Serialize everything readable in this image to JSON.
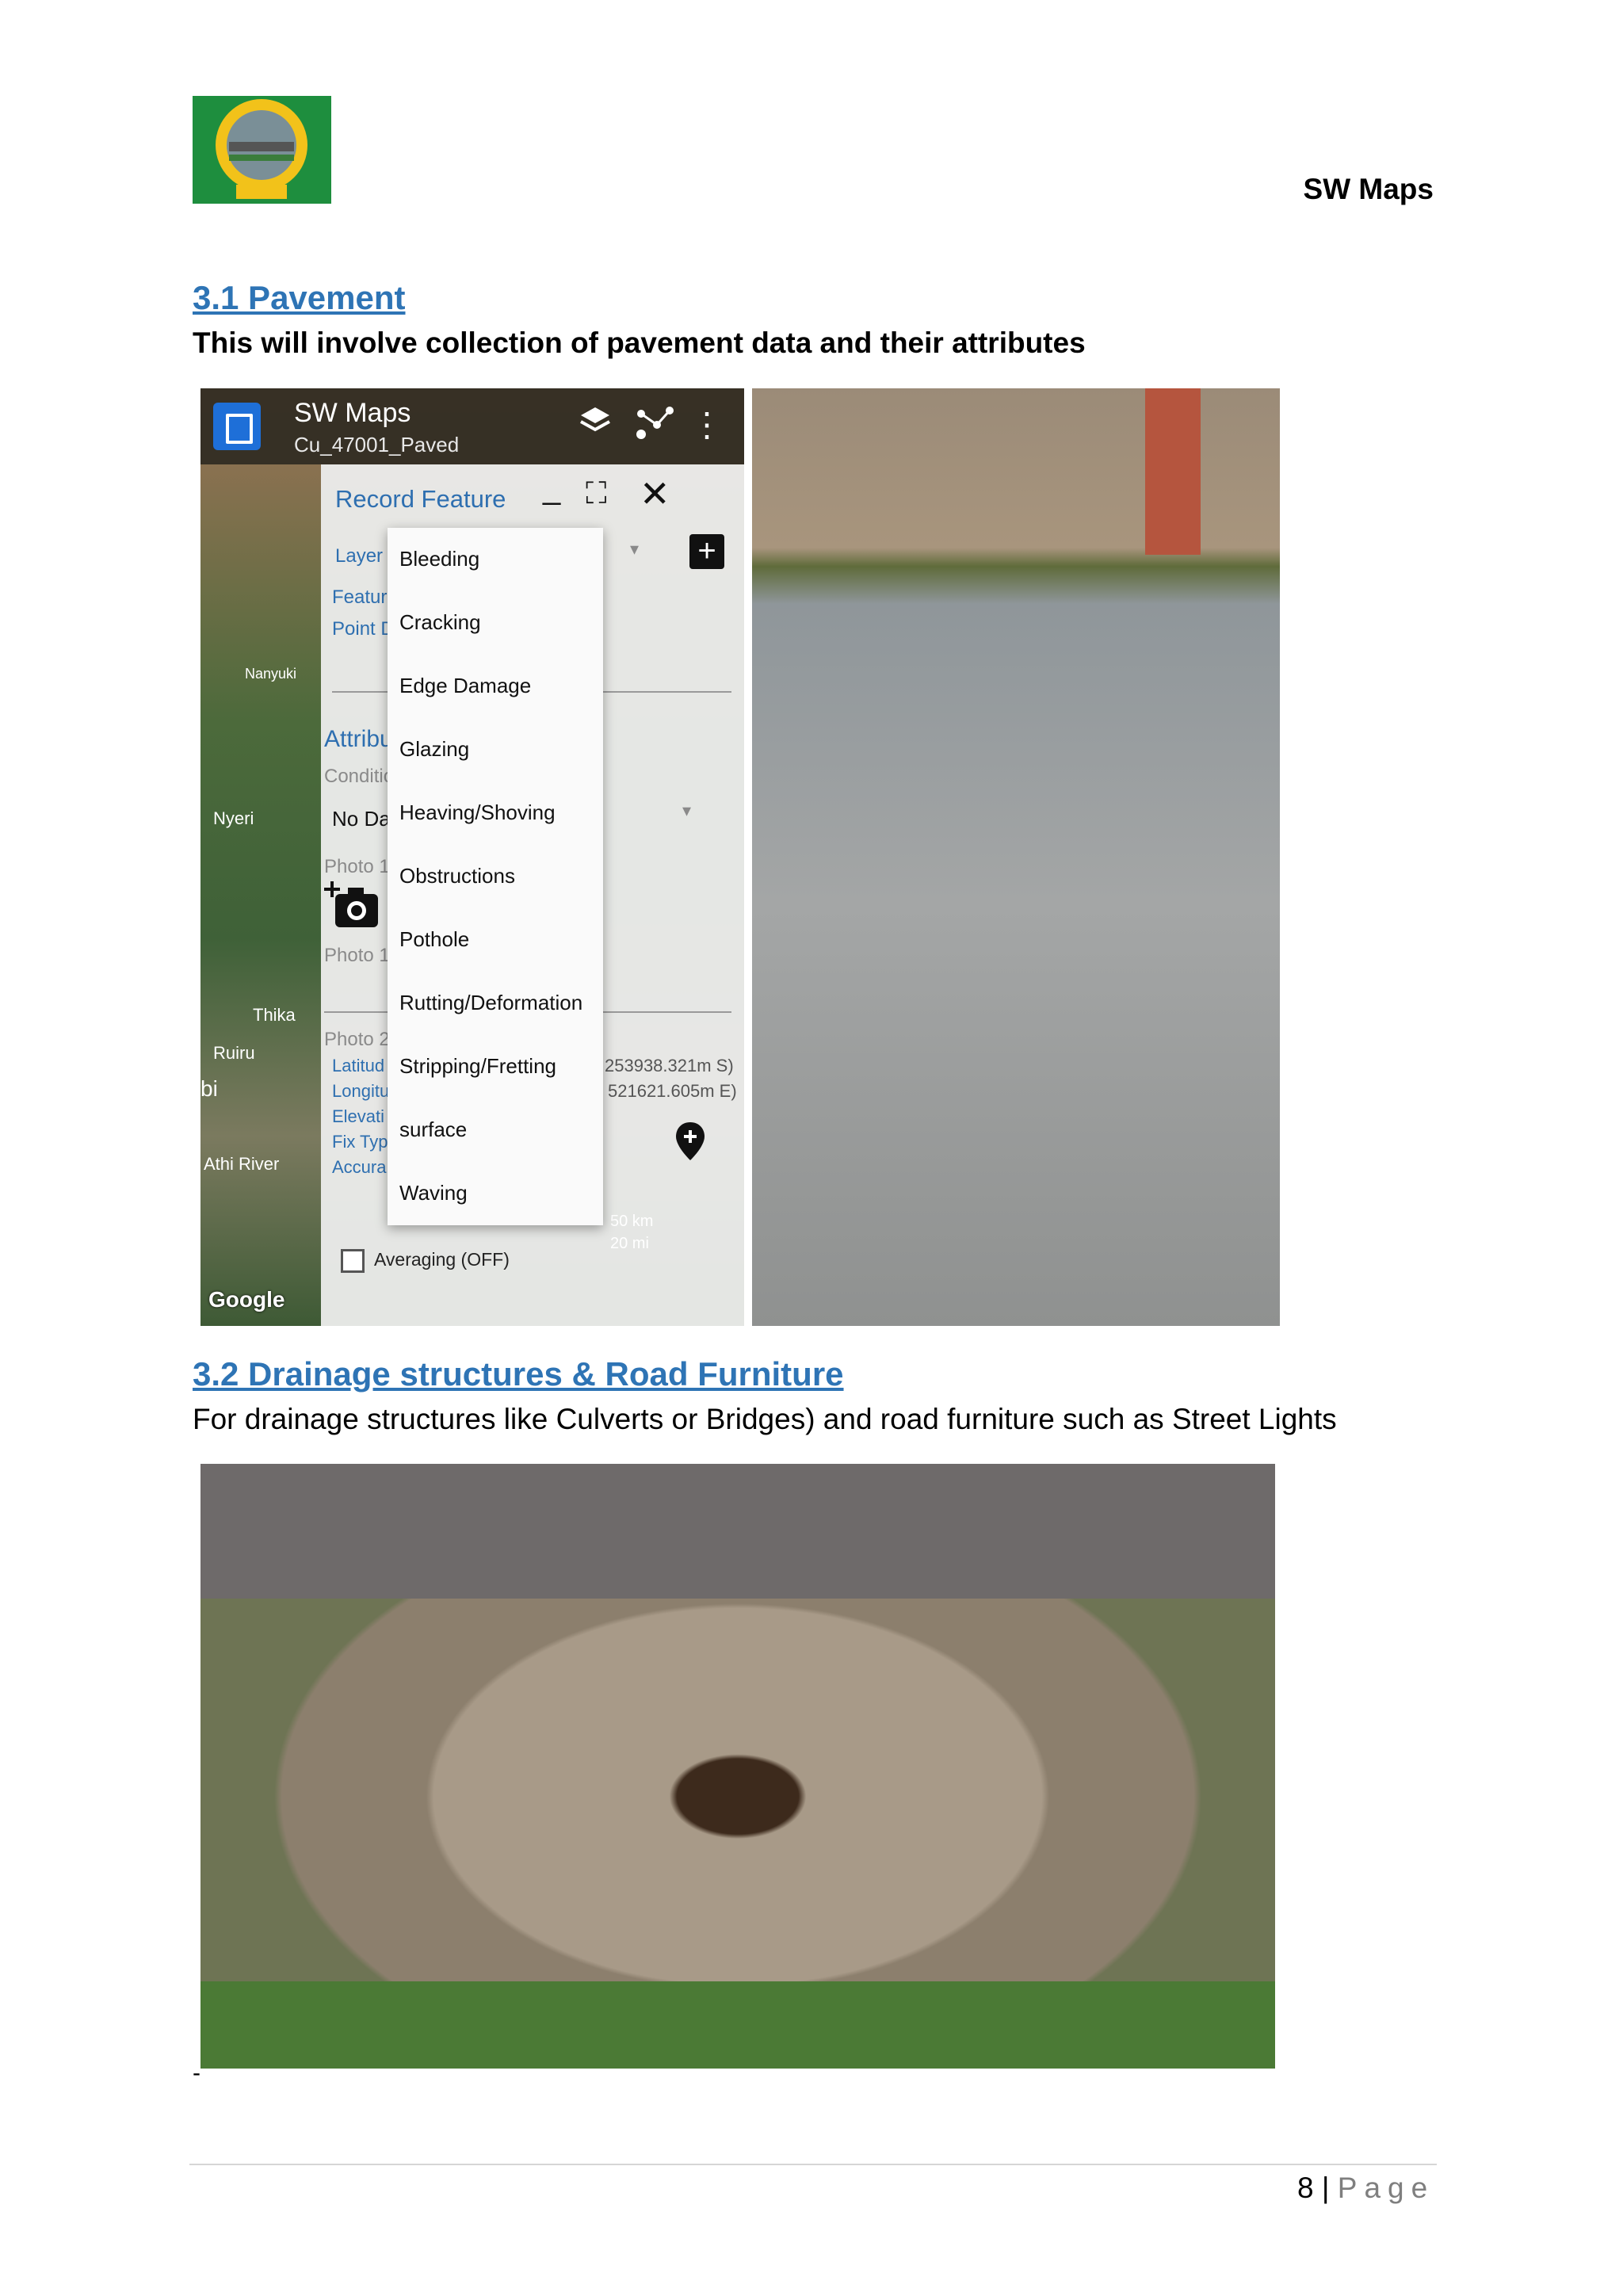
{
  "header": {
    "logo_alt": "KURA",
    "title": "SW Maps"
  },
  "section_pavement": {
    "heading": "3.1 Pavement",
    "description": "This will involve collection of pavement data and their attributes"
  },
  "app_screenshot": {
    "app_title": "SW Maps",
    "project": "Cu_47001_Paved",
    "dialog_title": "Record Feature",
    "layer_label": "Layer",
    "feature_label": "Feature",
    "point_label": "Point D",
    "attributes_label": "Attribu",
    "condition_label": "Conditio",
    "no_data": "No Da",
    "photo1_label": "Photo 1",
    "photo2_label": "Photo 2",
    "lat_label": "Latitud",
    "lon_label": "Longitu",
    "elev_label": "Elevati",
    "fix_label": "Fix Typ",
    "acc_label": "Accura",
    "lat_value": "253938.321m S)",
    "lon_value": "521621.605m E)",
    "map_labels": [
      "Nanyuki",
      "Nyeri",
      "Thika",
      "Ruiru",
      "Athi River",
      "bi"
    ],
    "menu_items": [
      "Bleeding",
      "Cracking",
      "Edge Damage",
      "Glazing",
      "Heaving/Shoving",
      "Obstructions",
      "Pothole",
      "Rutting/Deformation",
      "Stripping/Fretting",
      "surface",
      "Waving"
    ],
    "averaging": "Averaging (OFF)",
    "google": "Google",
    "scale_km": "50 km",
    "scale_mi": "20 mi"
  },
  "section_drainage": {
    "heading": "3.2 Drainage structures & Road Furniture",
    "description": "For drainage structures like Culverts or Bridges) and road furniture such as Street Lights"
  },
  "footer": {
    "dash": "-",
    "page_number": "8",
    "separator": "|",
    "page_word": "Page"
  }
}
